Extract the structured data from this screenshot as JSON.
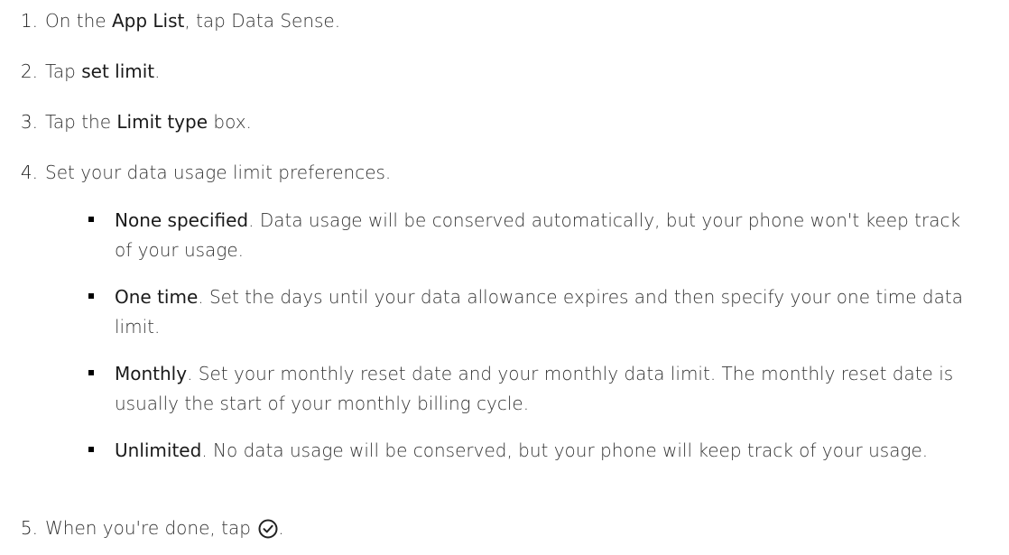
{
  "steps": [
    {
      "number": "1.",
      "pre": "On the ",
      "bold": "App List",
      "post": ", tap Data Sense."
    },
    {
      "number": "2.",
      "pre": "Tap ",
      "bold": "set limit",
      "post": "."
    },
    {
      "number": "3.",
      "pre": "Tap the ",
      "bold": "Limit type",
      "post": " box."
    },
    {
      "number": "4.",
      "pre": "Set your data usage limit preferences.",
      "bold": "",
      "post": ""
    },
    {
      "number": "5.",
      "pre": "When you're done, tap ",
      "bold": "",
      "post": "."
    }
  ],
  "options": [
    {
      "name": "None specified",
      "desc": ". Data usage will be conserved automatically, but your phone won't keep track of your usage."
    },
    {
      "name": "One time",
      "desc": ". Set the days until your data allowance expires and then specify your one time data limit."
    },
    {
      "name": "Monthly",
      "desc": ". Set your monthly reset date and your monthly data limit. The monthly reset date is usually the start of your monthly billing cycle."
    },
    {
      "name": "Unlimited",
      "desc": ". No data usage will be conserved, but your phone will keep track of your usage."
    }
  ],
  "icons": {
    "done": "check-circle-icon"
  }
}
